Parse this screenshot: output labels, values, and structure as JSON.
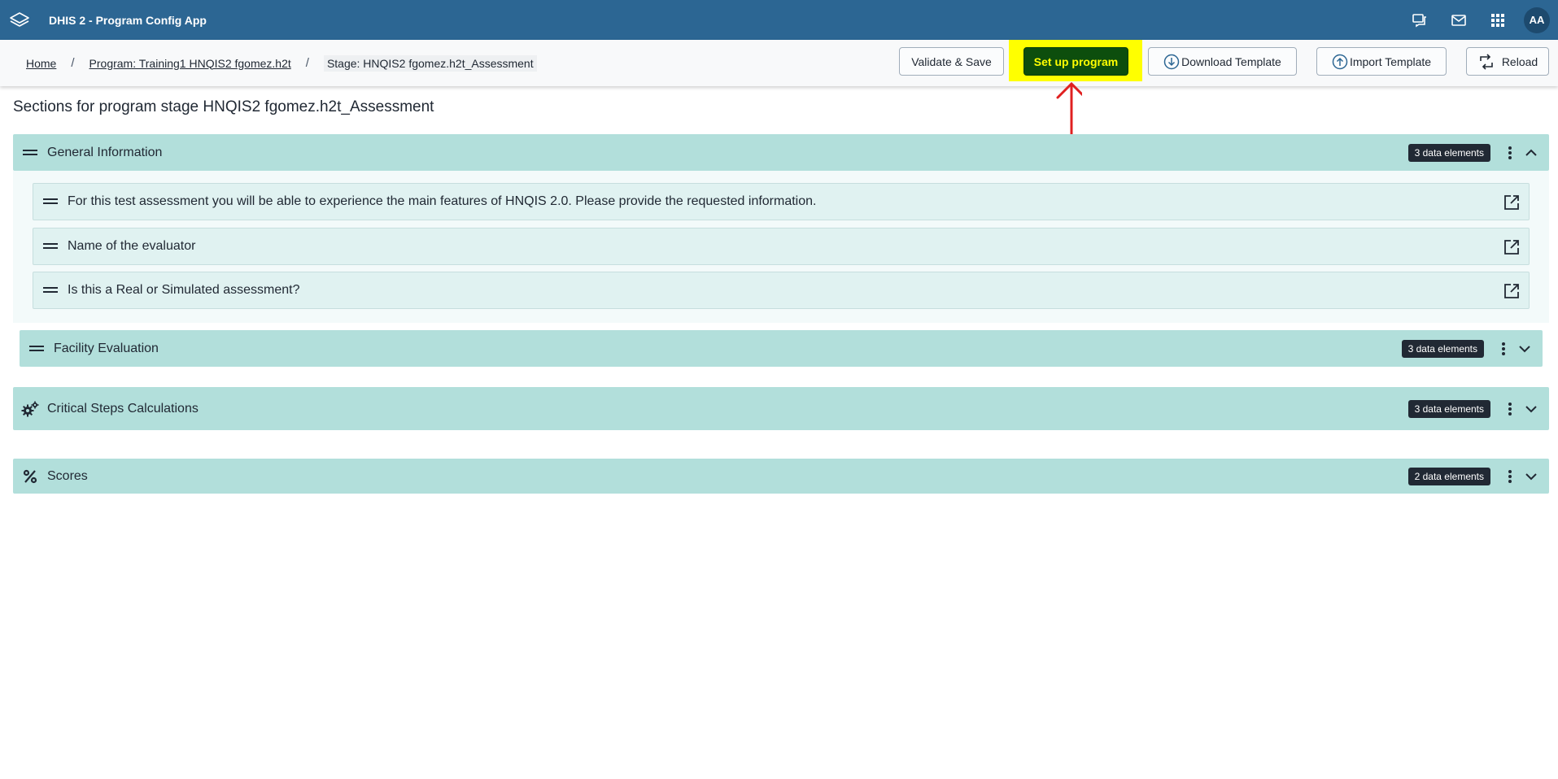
{
  "header": {
    "app_title": "DHIS 2 - Program Config App",
    "avatar_initials": "AA",
    "icons": [
      "dhis2-logo-icon",
      "interpretations-icon",
      "messages-icon",
      "apps-grid-icon"
    ]
  },
  "breadcrumb": {
    "home": "Home",
    "program": "Program: Training1 HNQIS2 fgomez.h2t",
    "stage": "Stage: HNQIS2 fgomez.h2t_Assessment",
    "separator": "/"
  },
  "toolbar": {
    "validate_save": "Validate & Save",
    "setup_program": "Set up program",
    "download_template": "Download Template",
    "import_template": "Import Template",
    "reload": "Reload"
  },
  "colors": {
    "header_bg": "#2c6693",
    "section_bg": "#b2dfdb",
    "row_bg": "#e0f2f1",
    "highlight": "#ffff00",
    "primary_btn": "#0d4e0d",
    "annotation_arrow": "#e02020"
  },
  "page_heading": "Sections for program stage HNQIS2 fgomez.h2t_Assessment",
  "sections": [
    {
      "title": "General Information",
      "badge": "3 data elements",
      "icon": "drag-handle-icon",
      "expanded": true,
      "data_elements": [
        {
          "label": "For this test assessment you will be able to experience the main features of HNQIS 2.0. Please provide the requested information."
        },
        {
          "label": "Name of the evaluator"
        },
        {
          "label": "Is this a Real or Simulated assessment?"
        }
      ]
    },
    {
      "title": "Facility Evaluation",
      "badge": "3 data elements",
      "icon": "drag-handle-icon",
      "expanded": false
    },
    {
      "title": "Critical Steps Calculations",
      "badge": "3 data elements",
      "icon": "gears-icon",
      "expanded": false
    },
    {
      "title": "Scores",
      "badge": "2 data elements",
      "icon": "percent-icon",
      "expanded": false
    }
  ]
}
